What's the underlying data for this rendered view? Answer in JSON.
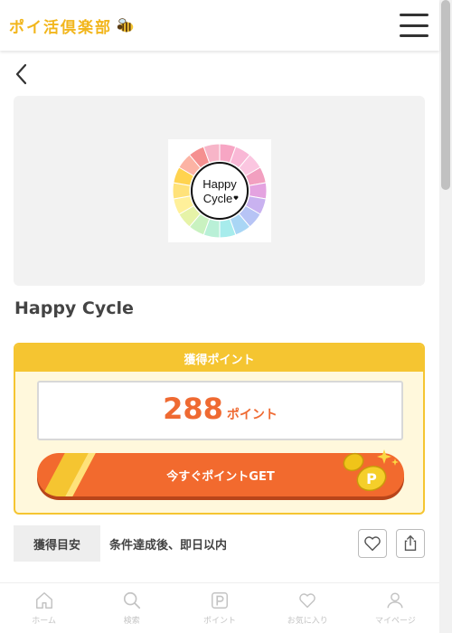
{
  "header": {
    "logo_text": "ポイ活倶楽部"
  },
  "app": {
    "logo_text_line1": "Happy",
    "logo_text_line2": "Cycle",
    "title": "Happy Cycle"
  },
  "points": {
    "header_label": "獲得ポイント",
    "value": "288",
    "unit": "ポイント",
    "get_button_label": "今すぐポイントGET"
  },
  "estimate": {
    "label": "獲得目安",
    "value": "条件達成後、即日以内"
  },
  "tabbar": {
    "items": [
      {
        "label": "ホーム",
        "icon": "home-icon"
      },
      {
        "label": "検索",
        "icon": "search-icon"
      },
      {
        "label": "ポイント",
        "icon": "point-icon"
      },
      {
        "label": "お気に入り",
        "icon": "heart-icon"
      },
      {
        "label": "マイページ",
        "icon": "user-icon"
      }
    ]
  },
  "colors": {
    "brand_yellow": "#f5c531",
    "accent_orange": "#ef6a32"
  }
}
